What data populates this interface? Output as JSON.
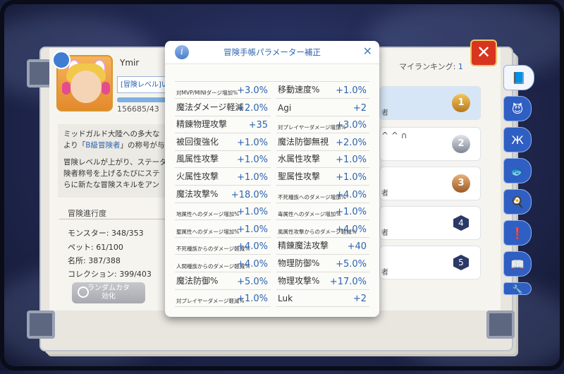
{
  "profile": {
    "name": "Ymir",
    "level_label": "[冒険レベル]い",
    "xp_text": "156685/43",
    "xp_fraction": 0.92
  },
  "description": {
    "line1": "ミッドガルド大陸への多大な",
    "line2_pre": "より「",
    "line2_hl": "B級冒険者",
    "line2_post": "」の称号が与",
    "line3": "冒険レベルが上がり、ステータ",
    "line4": "険者称号を上げるたびにステ",
    "line5": "らに新たな冒険スキルをアン"
  },
  "progress": {
    "title": "冒険進行度",
    "monster": "モンスター: 348/353",
    "pet": "ペット: 61/100",
    "place": "名所: 387/388",
    "collection": "コレクション: 399/403"
  },
  "grey_button": {
    "line1": "ランダムカタ",
    "line2": "効化"
  },
  "ranking": {
    "label": "マイランキング: ",
    "value": "1",
    "rows": [
      {
        "rank": "1",
        "tail": "者"
      },
      {
        "rank": "2",
        "tail": "^ ^ ∩"
      },
      {
        "rank": "3",
        "tail": "者"
      },
      {
        "rank": "4",
        "tail": "者"
      },
      {
        "rank": "5",
        "tail": "者"
      }
    ]
  },
  "close_label": "✕",
  "tabs": [
    "📘",
    "😈",
    "Ж",
    "🐟",
    "🍳",
    "❗",
    "📖",
    "🔧"
  ],
  "modal": {
    "title": "冒険手帳パラメーター補正",
    "info": "i",
    "close": "✕",
    "rows": [
      [
        {
          "label": "対MVP/MINIダージ増加%",
          "value": "+3.0%",
          "small": true
        },
        {
          "label": "移動速度%",
          "value": "+1.0%",
          "small": false
        }
      ],
      [
        {
          "label": "魔法ダメージ軽減",
          "value": "+2.0%",
          "small": false
        },
        {
          "label": "Agi",
          "value": "+2",
          "small": false
        }
      ],
      [
        {
          "label": "精錬物理攻撃",
          "value": "+35",
          "small": false
        },
        {
          "label": "対プレイヤーダメージ増加%",
          "value": "+3.0%",
          "small": true
        }
      ],
      [
        {
          "label": "被回復強化",
          "value": "+1.0%",
          "small": false
        },
        {
          "label": "魔法防御無視",
          "value": "+2.0%",
          "small": false
        }
      ],
      [
        {
          "label": "風属性攻撃",
          "value": "+1.0%",
          "small": false
        },
        {
          "label": "水属性攻撃",
          "value": "+1.0%",
          "small": false
        }
      ],
      [
        {
          "label": "火属性攻撃",
          "value": "+1.0%",
          "small": false
        },
        {
          "label": "聖属性攻撃",
          "value": "+1.0%",
          "small": false
        }
      ],
      [
        {
          "label": "魔法攻撃%",
          "value": "+18.0%",
          "small": false
        },
        {
          "label": "不死種族へのダメージ増加%",
          "value": "+4.0%",
          "small": true
        }
      ],
      [
        {
          "label": "地属性へのダメージ増加%",
          "value": "+1.0%",
          "small": true
        },
        {
          "label": "毒属性へのダメージ増加%",
          "value": "+1.0%",
          "small": true
        }
      ],
      [
        {
          "label": "聖属性へのダメージ増加%",
          "value": "+1.0%",
          "small": true
        },
        {
          "label": "風属性攻撃からのダメージ軽減%",
          "value": "+4.0%",
          "small": true
        }
      ],
      [
        {
          "label": "不死種族からのダメージ軽減%",
          "value": "+4.0%",
          "small": true
        },
        {
          "label": "精錬魔法攻撃",
          "value": "+40",
          "small": false
        }
      ],
      [
        {
          "label": "人間種族からのダメージ軽減%",
          "value": "+4.0%",
          "small": true
        },
        {
          "label": "物理防御%",
          "value": "+5.0%",
          "small": false
        }
      ],
      [
        {
          "label": "魔法防御%",
          "value": "+5.0%",
          "small": false
        },
        {
          "label": "物理攻撃%",
          "value": "+17.0%",
          "small": false
        }
      ],
      [
        {
          "label": "対プレイヤーダメージ軽減%",
          "value": "+1.0%",
          "small": true
        },
        {
          "label": "Luk",
          "value": "+2",
          "small": false
        }
      ]
    ]
  }
}
